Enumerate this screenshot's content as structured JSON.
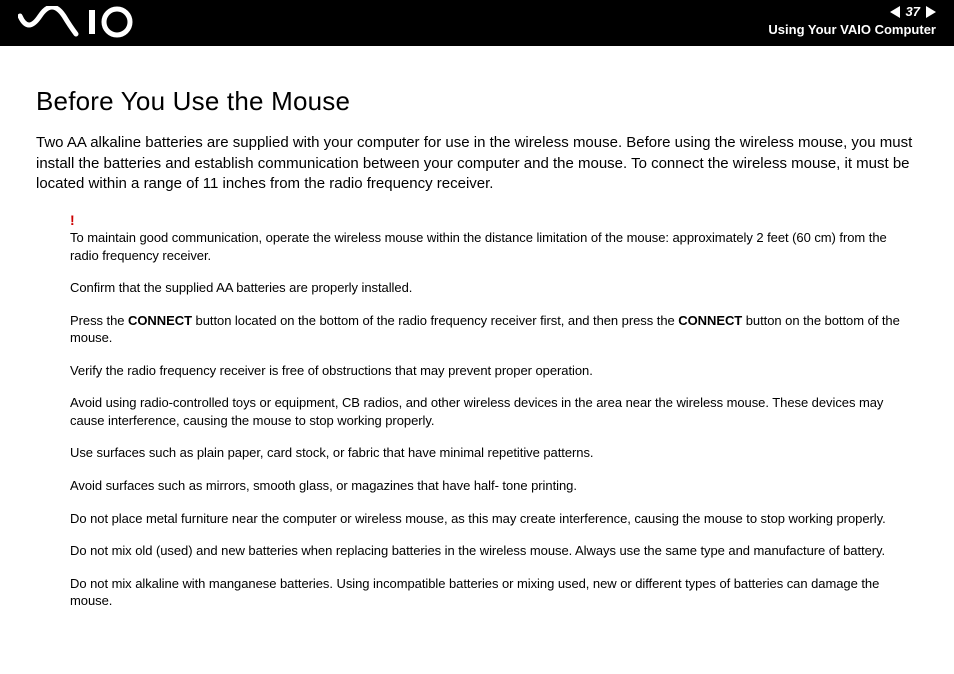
{
  "header": {
    "page_number": "37",
    "section": "Using Your VAIO Computer"
  },
  "content": {
    "heading": "Before You Use the Mouse",
    "intro": "Two AA alkaline batteries are supplied with your computer for use in the wireless mouse. Before using the wireless mouse, you must install the batteries and establish communication between your computer and the mouse. To connect the wireless mouse, it must be located within a range of 11 inches from the radio frequency receiver.",
    "bang": "!",
    "notes": {
      "n1": "To maintain good communication, operate the wireless mouse within the distance limitation of the mouse: approximately 2 feet (60 cm) from the radio frequency receiver.",
      "n2": "Confirm that the supplied AA batteries are properly installed.",
      "n3a": "Press the ",
      "n3b": "CONNECT",
      "n3c": " button located on the bottom of the radio frequency receiver first, and then press the ",
      "n3d": "CONNECT",
      "n3e": " button on the bottom of the mouse.",
      "n4": "Verify the radio frequency receiver is free of obstructions that may prevent proper operation.",
      "n5": "Avoid using radio-controlled toys or equipment, CB radios, and other wireless devices in the area near the wireless mouse. These devices may cause interference, causing the mouse to stop working properly.",
      "n6": "Use surfaces such as plain paper, card stock, or fabric that have minimal repetitive patterns.",
      "n7": "Avoid surfaces such as mirrors, smooth glass, or magazines that have half- tone printing.",
      "n8": "Do not place metal furniture near the computer or wireless mouse, as this may create interference, causing the mouse to stop working properly.",
      "n9": "Do not mix old (used) and new batteries when replacing batteries in the wireless mouse. Always use the same type and manufacture of battery.",
      "n10": "Do not mix alkaline with manganese batteries. Using incompatible batteries or mixing used, new or different types of batteries can damage the mouse."
    }
  }
}
